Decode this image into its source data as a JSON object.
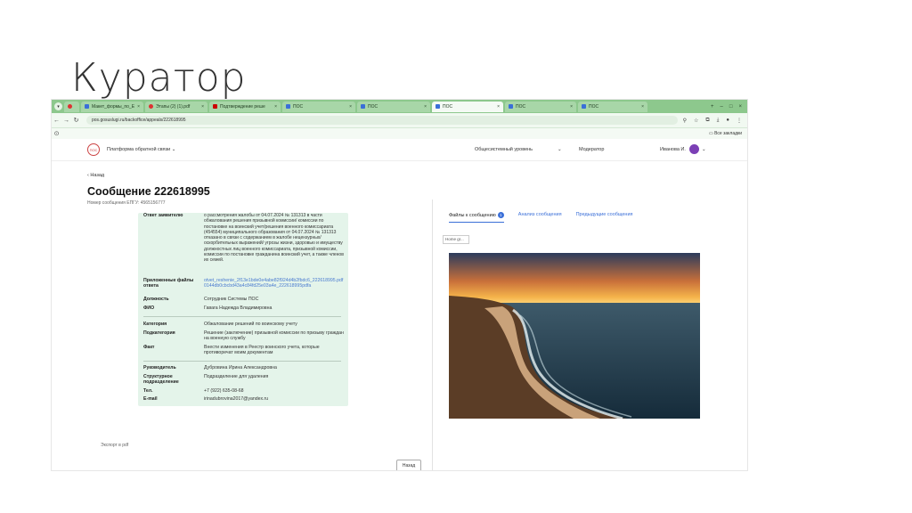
{
  "slide": {
    "title": "Куратор"
  },
  "browser": {
    "tabs": [
      {
        "label": "Макет_формы_по_ЕУ",
        "active": false
      },
      {
        "label": "Этапы (2) (1).pdf",
        "active": false
      },
      {
        "label": "Подтверждение реше",
        "active": false
      },
      {
        "label": "ПОС",
        "active": false
      },
      {
        "label": "ПОС",
        "active": false
      },
      {
        "label": "ПОС",
        "active": true
      },
      {
        "label": "ПОС",
        "active": false
      },
      {
        "label": "ПОС",
        "active": false
      }
    ],
    "url": "pos.gosuslugi.ru/backoffice/appeals/222618995",
    "bookmarks_label": "Все закладки"
  },
  "app": {
    "platform_name": "Платформа обратной связи",
    "level": "Общесистемный уровень",
    "role": "Модератор",
    "user": "Иванова И.",
    "back_link": "Назад",
    "title": "Сообщение 222618995",
    "subtitle": "Номер сообщения ЕПГУ: 4565156777",
    "fields": {
      "answer_label": "Ответ заявителю",
      "answer_text": "о рассмотрения жалобы от 04.07.2024 № 131313 в части обжалования решения призывной комиссии/ комиссии по постановке на воинский учет/решения военного комиссариата (454554) муниципального образования от 04.07.2024 № 131313 отказано в связи с содержанием в жалобе нецензурных/оскорбительных выражений/ угрозы жизни, здоровью и имуществу должностных лиц военного комиссариата, призывной комиссии, комиссии по постановке гражданина воинский учет, а также членов их семей.",
      "files_label": "Приложенные файлы ответа",
      "files_value": "otvet_reshenie_2f13e1bde0e4abe82f924d4b2fbdc6_222618995.pdf 0144db0cbcbd43a4c84fd25e03a4e_222618995pdfа",
      "position_label": "Должность",
      "position_value": "Сотрудник Системы ПОС",
      "fio_label": "ФИО",
      "fio_value": "Гавага Надежда Владимировна",
      "category_label": "Категория",
      "category_value": "Обжалование решений по воинскому учету",
      "subcategory_label": "Подкатегория",
      "subcategory_value": "Решение (заключение) призывной комиссии по призыву граждан на военную службу",
      "fact_label": "Факт",
      "fact_value": "Внести изменения в Реестр воинского учета, которые противоречат моим документам",
      "head_label": "Руководитель",
      "head_value": "Дубровина Ирина Александровна",
      "unit_label": "Структурное подразделение",
      "unit_value": "Подразделение для удаления",
      "phone_label": "Тел.",
      "phone_value": "+7 (922) 635-08-68",
      "email_label": "E-mail",
      "email_value": "irinadubrovina2017@yandex.ru"
    },
    "right_tabs": {
      "files": "Файлы к сообщению",
      "files_count": "1",
      "analysis": "Анализ сообщения",
      "previous": "Предыдущие сообщения"
    },
    "file_chip": "Home gr...",
    "export_label": "Экспорт в pdf",
    "back_button": "Назад"
  },
  "colors": {
    "tabbar": "#8dc88d",
    "card_bg": "#e4f4ea",
    "accent": "#3a6fd8"
  }
}
